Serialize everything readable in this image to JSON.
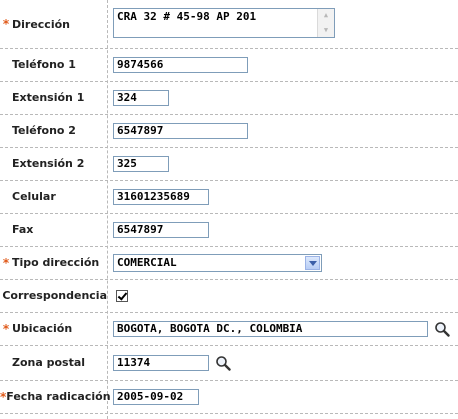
{
  "form": {
    "direccion": {
      "label": "Dirección",
      "required": true,
      "value": "CRA 32  # 45-98  AP 201"
    },
    "telefono1": {
      "label": "Teléfono 1",
      "required": false,
      "value": "9874566"
    },
    "extension1": {
      "label": "Extensión 1",
      "required": false,
      "value": "324"
    },
    "telefono2": {
      "label": "Teléfono 2",
      "required": false,
      "value": "6547897"
    },
    "extension2": {
      "label": "Extensión 2",
      "required": false,
      "value": "325"
    },
    "celular": {
      "label": "Celular",
      "required": false,
      "value": "31601235689"
    },
    "fax": {
      "label": "Fax",
      "required": false,
      "value": "6547897"
    },
    "tipo_direccion": {
      "label": "Tipo dirección",
      "required": true,
      "selected": "COMERCIAL"
    },
    "correspondencia": {
      "label": "Correspondencia",
      "required": false,
      "checked": true
    },
    "ubicacion": {
      "label": "Ubicación",
      "required": true,
      "value": "BOGOTA, BOGOTA DC., COLOMBIA"
    },
    "zona_postal": {
      "label": "Zona postal",
      "required": false,
      "value": "11374"
    },
    "fecha_radicacion": {
      "label": "Fecha radicación",
      "required": true,
      "value": "2005-09-02"
    }
  },
  "required_marker": "*",
  "icons": {
    "search": "magnifier-icon"
  },
  "colors": {
    "required": "#e05a1a",
    "border": "#7f9db9",
    "divider": "#b9b9b9"
  }
}
